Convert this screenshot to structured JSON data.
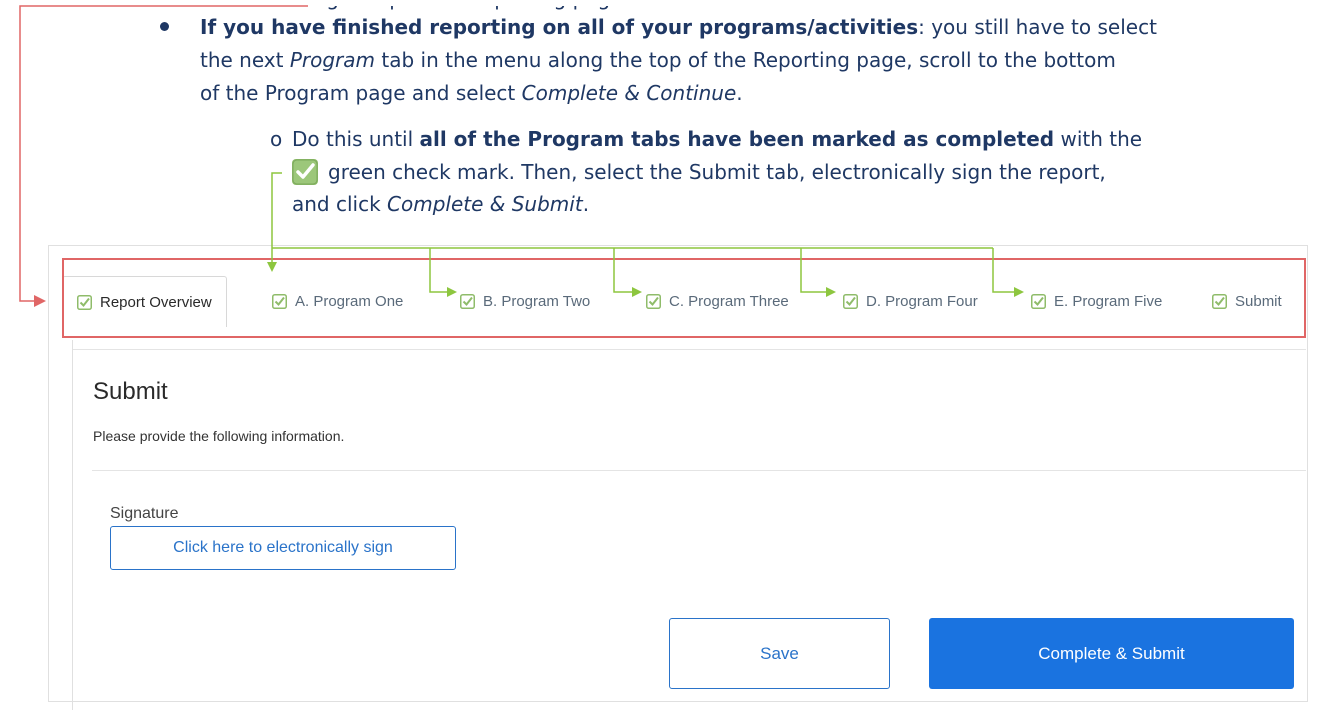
{
  "doc": {
    "cut_text": "ing and prior to Reporting page",
    "bullet_bold": "If you have finished reporting on all of your programs/activities",
    "bullet_rest1": ": you still have to select",
    "line2_pre": "the next ",
    "line2_italic": "Program",
    "line2_post": " tab in the menu along the top of the Reporting page, scroll to the bottom",
    "line3_pre": "of the Program page and select ",
    "line3_italic": "Complete & Continue",
    "line3_post": ".",
    "sub_bullet": "o",
    "sub_pre": "Do this until ",
    "sub_bold": "all of the Program tabs have been marked as completed",
    "sub_post": " with the",
    "sub_line2": "green check mark. Then, select the Submit tab, electronically sign the report,",
    "sub_line3_pre": "and click ",
    "sub_line3_italic": "Complete & Submit",
    "sub_line3_post": "."
  },
  "tabs": [
    {
      "label": "Report Overview"
    },
    {
      "label": "A. Program One"
    },
    {
      "label": "B. Program Two"
    },
    {
      "label": "C. Program Three"
    },
    {
      "label": "D. Program Four"
    },
    {
      "label": "E. Program Five"
    },
    {
      "label": "Submit"
    }
  ],
  "submit": {
    "title": "Submit",
    "subtitle": "Please provide the following information.",
    "signature_label": "Signature",
    "sign_button": "Click here to electronically sign",
    "save_button": "Save",
    "complete_button": "Complete & Submit"
  },
  "colors": {
    "doc_text": "#1f3864",
    "check_green": "#8fbc6a",
    "arrow_green": "#8dc63f",
    "red_frame": "#e06666",
    "primary_blue": "#1a73e0"
  }
}
